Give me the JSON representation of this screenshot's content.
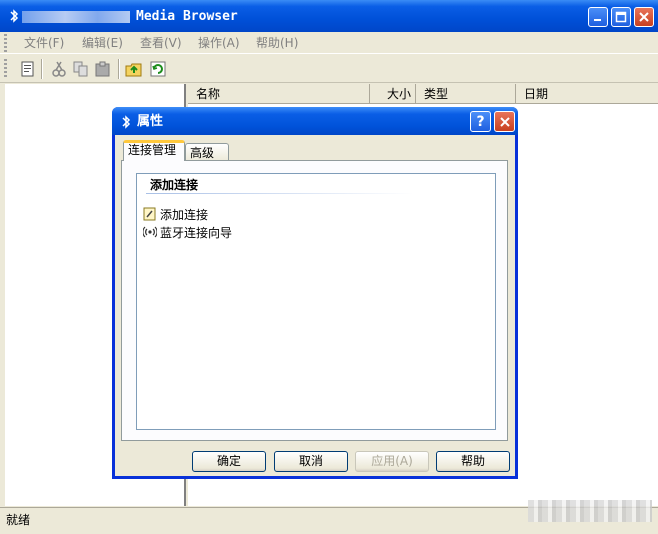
{
  "window": {
    "title": "Media Browser"
  },
  "menu": [
    {
      "label": "文件(F)"
    },
    {
      "label": "编辑(E)"
    },
    {
      "label": "查看(V)"
    },
    {
      "label": "操作(A)"
    },
    {
      "label": "帮助(H)"
    }
  ],
  "list_columns": [
    "名称",
    "大小",
    "类型",
    "日期"
  ],
  "status": {
    "text": "就绪"
  },
  "dialog": {
    "title": "属性",
    "tabs": [
      "连接管理",
      "高级"
    ],
    "group_title": "添加连接",
    "items": [
      "添加连接",
      "蓝牙连接向导"
    ],
    "buttons": {
      "ok": "确定",
      "cancel": "取消",
      "apply": "应用(A)",
      "help": "帮助"
    }
  },
  "icons": {
    "app": "bluetooth-icon",
    "toolbar": [
      "properties-icon",
      "cut-icon",
      "copy-icon",
      "paste-icon",
      "folder-up-icon",
      "refresh-icon"
    ],
    "items": [
      "wizard-icon",
      "bluetooth-signal-icon"
    ]
  },
  "colors": {
    "titlebar": "#0a5ee6",
    "dialog_border": "#0831d9",
    "tab_highlight": "#ffc83c"
  }
}
